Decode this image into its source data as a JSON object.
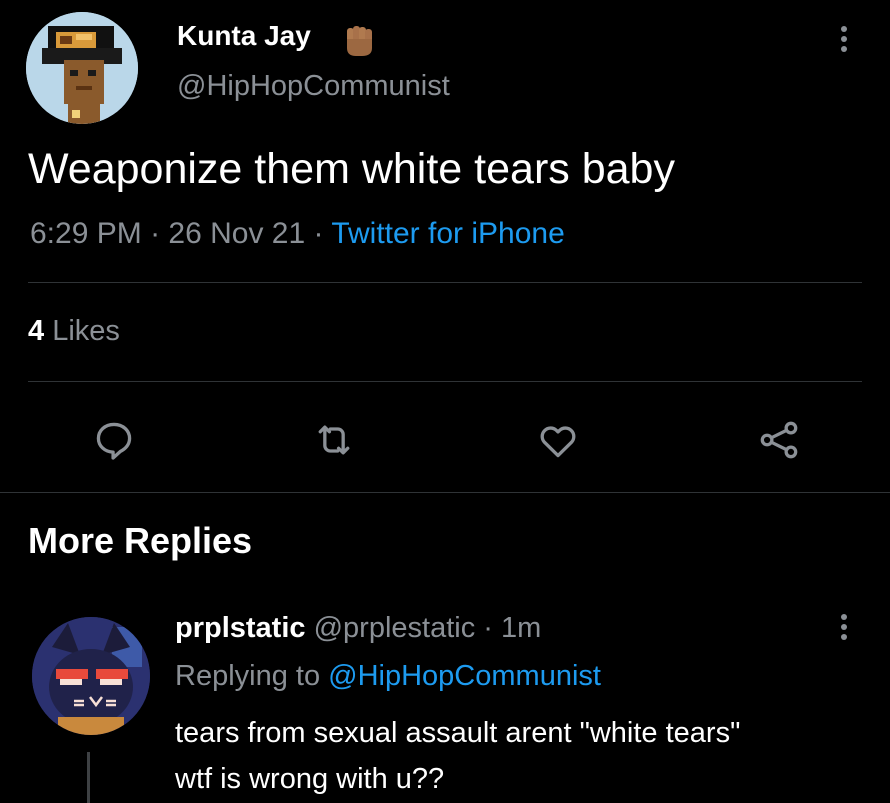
{
  "tweet": {
    "display_name": "Kunta Jay",
    "handle": "@HipHopCommunist",
    "text": "Weaponize them white tears baby",
    "time": "6:29 PM",
    "date": "26 Nov 21",
    "source": "Twitter for iPhone",
    "likes_count": "4",
    "likes_label": "Likes",
    "more_icon": "more-vertical-icon"
  },
  "actions": [
    {
      "icon": "reply-icon"
    },
    {
      "icon": "retweet-icon"
    },
    {
      "icon": "like-icon"
    },
    {
      "icon": "share-icon"
    }
  ],
  "section_title": "More Replies",
  "reply": {
    "display_name": "prplstatic",
    "handle": "@prplestatic",
    "time_ago": "1m",
    "replying_prefix": "Replying to",
    "replying_to": "@HipHopCommunist",
    "text_line1": "tears from sexual assault arent \"white tears\"",
    "text_line2": "wtf is wrong with u??"
  },
  "colors": {
    "background": "#000000",
    "text_primary": "#e7e9ea",
    "text_secondary": "#8b9096",
    "link": "#1d9bf0",
    "divider": "#2f3336"
  }
}
